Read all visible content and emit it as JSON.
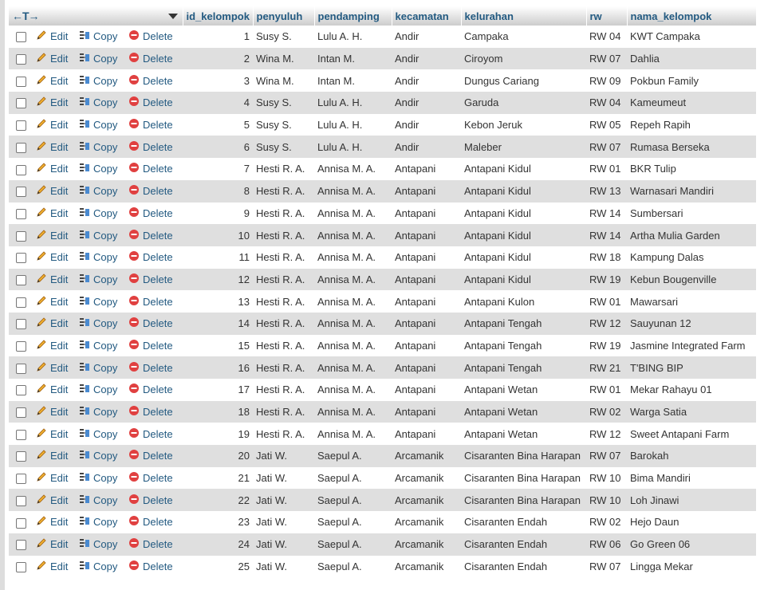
{
  "header": {
    "arrows": "←T→",
    "columns": [
      "id_kelompok",
      "penyuluh",
      "pendamping",
      "kecamatan",
      "kelurahan",
      "rw",
      "nama_kelompok"
    ]
  },
  "actions": {
    "edit": "Edit",
    "copy": "Copy",
    "delete": "Delete"
  },
  "rows": [
    {
      "id": "1",
      "penyuluh": "Susy S.",
      "pendamping": "Lulu A. H.",
      "kecamatan": "Andir",
      "kelurahan": "Campaka",
      "rw": "RW 04",
      "nama": "KWT Campaka"
    },
    {
      "id": "2",
      "penyuluh": "Wina M.",
      "pendamping": "Intan M.",
      "kecamatan": "Andir",
      "kelurahan": "Ciroyom",
      "rw": "RW 07",
      "nama": "Dahlia"
    },
    {
      "id": "3",
      "penyuluh": "Wina M.",
      "pendamping": "Intan M.",
      "kecamatan": "Andir",
      "kelurahan": "Dungus Cariang",
      "rw": "RW 09",
      "nama": "Pokbun Family"
    },
    {
      "id": "4",
      "penyuluh": "Susy S.",
      "pendamping": "Lulu A. H.",
      "kecamatan": "Andir",
      "kelurahan": "Garuda",
      "rw": "RW 04",
      "nama": "Kameumeut"
    },
    {
      "id": "5",
      "penyuluh": "Susy S.",
      "pendamping": "Lulu A. H.",
      "kecamatan": "Andir",
      "kelurahan": "Kebon Jeruk",
      "rw": "RW 05",
      "nama": "Repeh Rapih"
    },
    {
      "id": "6",
      "penyuluh": "Susy S.",
      "pendamping": "Lulu A. H.",
      "kecamatan": "Andir",
      "kelurahan": "Maleber",
      "rw": "RW 07",
      "nama": "Rumasa Berseka"
    },
    {
      "id": "7",
      "penyuluh": "Hesti R. A.",
      "pendamping": "Annisa M. A.",
      "kecamatan": "Antapani",
      "kelurahan": "Antapani Kidul",
      "rw": "RW 01",
      "nama": "BKR Tulip"
    },
    {
      "id": "8",
      "penyuluh": "Hesti R. A.",
      "pendamping": "Annisa M. A.",
      "kecamatan": "Antapani",
      "kelurahan": "Antapani Kidul",
      "rw": "RW 13",
      "nama": "Warnasari Mandiri"
    },
    {
      "id": "9",
      "penyuluh": "Hesti R. A.",
      "pendamping": "Annisa M. A.",
      "kecamatan": "Antapani",
      "kelurahan": "Antapani Kidul",
      "rw": "RW 14",
      "nama": "Sumbersari"
    },
    {
      "id": "10",
      "penyuluh": "Hesti R. A.",
      "pendamping": "Annisa M. A.",
      "kecamatan": "Antapani",
      "kelurahan": "Antapani Kidul",
      "rw": "RW 14",
      "nama": "Artha Mulia Garden"
    },
    {
      "id": "11",
      "penyuluh": "Hesti R. A.",
      "pendamping": "Annisa M. A.",
      "kecamatan": "Antapani",
      "kelurahan": "Antapani Kidul",
      "rw": "RW 18",
      "nama": "Kampung Dalas"
    },
    {
      "id": "12",
      "penyuluh": "Hesti R. A.",
      "pendamping": "Annisa M. A.",
      "kecamatan": "Antapani",
      "kelurahan": "Antapani Kidul",
      "rw": "RW 19",
      "nama": "Kebun Bougenville"
    },
    {
      "id": "13",
      "penyuluh": "Hesti R. A.",
      "pendamping": "Annisa M. A.",
      "kecamatan": "Antapani",
      "kelurahan": "Antapani Kulon",
      "rw": "RW 01",
      "nama": "Mawarsari"
    },
    {
      "id": "14",
      "penyuluh": "Hesti R. A.",
      "pendamping": "Annisa M. A.",
      "kecamatan": "Antapani",
      "kelurahan": "Antapani Tengah",
      "rw": "RW 12",
      "nama": "Sauyunan 12"
    },
    {
      "id": "15",
      "penyuluh": "Hesti R. A.",
      "pendamping": "Annisa M. A.",
      "kecamatan": "Antapani",
      "kelurahan": "Antapani Tengah",
      "rw": "RW 19",
      "nama": "Jasmine Integrated Farm"
    },
    {
      "id": "16",
      "penyuluh": "Hesti R. A.",
      "pendamping": "Annisa M. A.",
      "kecamatan": "Antapani",
      "kelurahan": "Antapani Tengah",
      "rw": "RW 21",
      "nama": "T'BING BIP"
    },
    {
      "id": "17",
      "penyuluh": "Hesti R. A.",
      "pendamping": "Annisa M. A.",
      "kecamatan": "Antapani",
      "kelurahan": "Antapani Wetan",
      "rw": "RW 01",
      "nama": "Mekar Rahayu 01"
    },
    {
      "id": "18",
      "penyuluh": "Hesti R. A.",
      "pendamping": "Annisa M. A.",
      "kecamatan": "Antapani",
      "kelurahan": "Antapani Wetan",
      "rw": "RW 02",
      "nama": "Warga Satia"
    },
    {
      "id": "19",
      "penyuluh": "Hesti R. A.",
      "pendamping": "Annisa M. A.",
      "kecamatan": "Antapani",
      "kelurahan": "Antapani Wetan",
      "rw": "RW 12",
      "nama": "Sweet Antapani Farm"
    },
    {
      "id": "20",
      "penyuluh": "Jati W.",
      "pendamping": "Saepul A.",
      "kecamatan": "Arcamanik",
      "kelurahan": "Cisaranten Bina Harapan",
      "rw": "RW 07",
      "nama": "Barokah"
    },
    {
      "id": "21",
      "penyuluh": "Jati W.",
      "pendamping": "Saepul A.",
      "kecamatan": "Arcamanik",
      "kelurahan": "Cisaranten Bina Harapan",
      "rw": "RW 10",
      "nama": "Bima Mandiri"
    },
    {
      "id": "22",
      "penyuluh": "Jati W.",
      "pendamping": "Saepul A.",
      "kecamatan": "Arcamanik",
      "kelurahan": "Cisaranten Bina Harapan",
      "rw": "RW 10",
      "nama": "Loh Jinawi"
    },
    {
      "id": "23",
      "penyuluh": "Jati W.",
      "pendamping": "Saepul A.",
      "kecamatan": "Arcamanik",
      "kelurahan": "Cisaranten Endah",
      "rw": "RW 02",
      "nama": "Hejo Daun"
    },
    {
      "id": "24",
      "penyuluh": "Jati W.",
      "pendamping": "Saepul A.",
      "kecamatan": "Arcamanik",
      "kelurahan": "Cisaranten Endah",
      "rw": "RW 06",
      "nama": "Go Green 06"
    },
    {
      "id": "25",
      "penyuluh": "Jati W.",
      "pendamping": "Saepul A.",
      "kecamatan": "Arcamanik",
      "kelurahan": "Cisaranten Endah",
      "rw": "RW 07",
      "nama": "Lingga Mekar"
    }
  ],
  "colors": {
    "link": "#235a81",
    "row_alt": "#dfdfdf",
    "delete_icon": "#e04040",
    "edit_icon": "#e8a020"
  }
}
